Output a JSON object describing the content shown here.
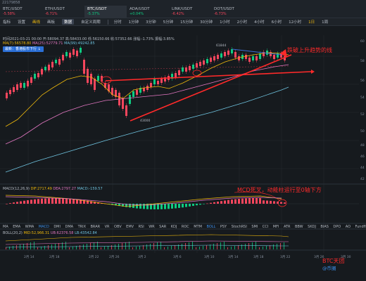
{
  "topbar": {
    "text": "22179858"
  },
  "tabs": [
    {
      "name": "BTC/USDT",
      "change": "-5.58%"
    },
    {
      "name": "ETH/USDT",
      "change": "-6.71%"
    },
    {
      "name": "BTC/USDT",
      "change": "-5.37%"
    },
    {
      "name": "ADA/USDT",
      "change": "+0.04%"
    },
    {
      "name": "LINK/USDT",
      "change": "-6.42%"
    },
    {
      "name": "DOT/USDT",
      "change": "-6.73%"
    }
  ],
  "toolbar": {
    "items": [
      "指标",
      "设置",
      "画线",
      "画板",
      "全屏"
    ],
    "selected": "数据",
    "mode": "自定义周期",
    "timeframes": [
      "分时",
      "1分钟",
      "3分钟",
      "5分钟",
      "15分钟",
      "30分钟",
      "1小时",
      "2小时",
      "4小时",
      "6小时",
      "12小时",
      "1日",
      "1周"
    ],
    "active_timeframe": "1日"
  },
  "info": {
    "ohlc": "时间2021-03-21 00:00 开:58094.37 高:58433.00 低:56150.66 收:57352.66 涨幅:-1.73% 振幅:3.85%",
    "ma7": "MA(7):56578.80",
    "ma25": "MA(25):52779.71",
    "ma99": "MA(99):49242.85",
    "badge": "最新：香港股市下行 ↓"
  },
  "price_labels": {
    "high": "61844",
    "low": "43000"
  },
  "macd": {
    "title": "MACD(12,26,9)",
    "dif": "DIF:2717.49",
    "dea": "DEA:2797.27",
    "macd": "MACD:-159.57"
  },
  "indicator_tabs": [
    "MA",
    "EMA",
    "WMA",
    "MACD",
    "DMI",
    "DMA",
    "TRIX",
    "BRAR",
    "VR",
    "OBV",
    "EMV",
    "RSI",
    "WR",
    "SAR",
    "KDJ",
    "ROC",
    "MTM",
    "BOLL",
    "PSY",
    "StochRSI",
    "SMI",
    "CCI",
    "MFI",
    "ATR",
    "BBW",
    "SKDJ",
    "BIAS",
    "DPO",
    "AO",
    "Fundflow"
  ],
  "active_indicators": [
    "MACD",
    "BOLL"
  ],
  "boll": {
    "title": "BOLL(20,2)",
    "mid": "MID:52,966.31",
    "ub": "UB:62376.58",
    "lb": "LB:43542.84"
  },
  "annotations": {
    "break": "跌破上升趋势的线",
    "macd": "MCD死叉，动能柱运行至0轴下方",
    "btc": "BTC天团",
    "watermark": "@币圈"
  },
  "x_axis_labels": [
    "2月 14",
    "2月 18",
    "2月 22",
    "2月 26",
    "3月 2",
    "3月 6",
    "3月 10",
    "3月 14",
    "3月 18",
    "3月 22",
    "3月 26",
    "3月 30"
  ],
  "y_axis_labels": [
    "60",
    "58",
    "56",
    "54",
    "52",
    "50",
    "48",
    "46",
    "44",
    "42"
  ],
  "colors": {
    "up": "#0ecb81",
    "down": "#f6465d",
    "ma7": "#f0b90b",
    "ma25": "#e377c2",
    "ma99": "#6fc3df",
    "annotation": "#ff2a2a",
    "bg": "#161a1e"
  }
}
